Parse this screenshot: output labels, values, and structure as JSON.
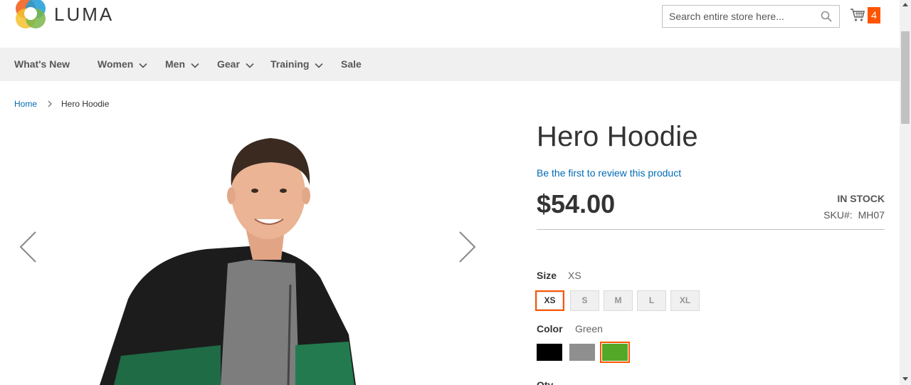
{
  "header": {
    "logo_text": "LUMA",
    "search_placeholder": "Search entire store here...",
    "cart_count": "4",
    "colors": {
      "accent": "#ff5501",
      "logo_orange": "#f26322",
      "logo_yellow": "#f5c12e",
      "logo_green": "#7ab648",
      "logo_blue": "#1d9bd7"
    }
  },
  "nav": {
    "items": [
      {
        "label": "What's New",
        "has_dropdown": false
      },
      {
        "label": "Women",
        "has_dropdown": true
      },
      {
        "label": "Men",
        "has_dropdown": true
      },
      {
        "label": "Gear",
        "has_dropdown": true
      },
      {
        "label": "Training",
        "has_dropdown": true
      },
      {
        "label": "Sale",
        "has_dropdown": false
      }
    ]
  },
  "breadcrumb": {
    "home": "Home",
    "current": "Hero Hoodie"
  },
  "product": {
    "title": "Hero Hoodie",
    "review_link": "Be the first to review this product",
    "price": "$54.00",
    "stock": "In stock",
    "sku_label": "SKU#:",
    "sku": "MH07"
  },
  "options": {
    "size": {
      "label": "Size",
      "selected": "XS",
      "values": [
        "XS",
        "S",
        "M",
        "L",
        "XL"
      ]
    },
    "color": {
      "label": "Color",
      "selected": "Green",
      "values": [
        {
          "name": "Black",
          "hex": "#000000"
        },
        {
          "name": "Gray",
          "hex": "#8f8f8f"
        },
        {
          "name": "Green",
          "hex": "#53a828"
        }
      ]
    },
    "qty_label": "Qty"
  }
}
